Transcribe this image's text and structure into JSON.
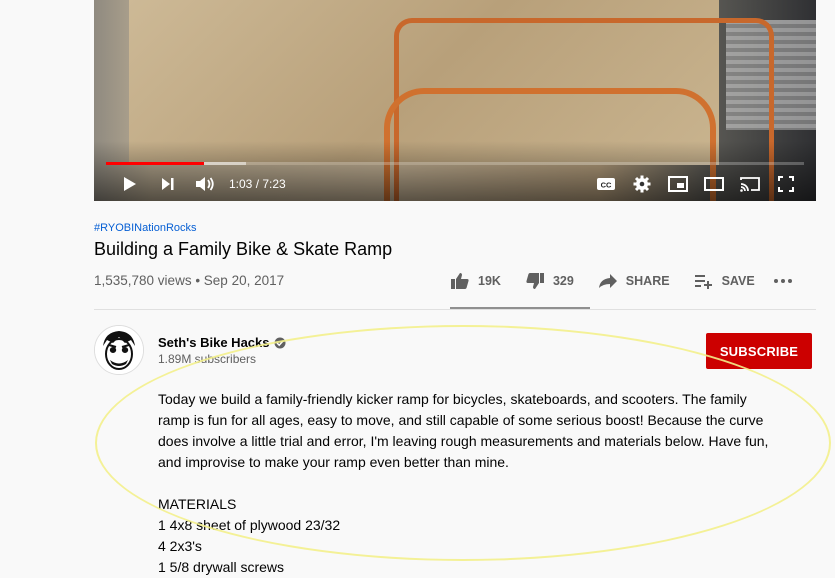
{
  "player": {
    "time": "1:03 / 7:23",
    "progress_played": 0.14,
    "progress_buffered": 0.2,
    "controls": [
      "play-icon",
      "next-icon",
      "volume-icon",
      "captions-icon",
      "settings-icon",
      "miniplayer-icon",
      "theater-icon",
      "cast-icon",
      "fullscreen-icon"
    ]
  },
  "video": {
    "hashtag": "#RYOBINationRocks",
    "title": "Building a Family Bike & Skate Ramp",
    "views_date": "1,535,780 views • Sep 20, 2017",
    "likes": "19K",
    "dislikes": "329",
    "share_label": "SHARE",
    "save_label": "SAVE"
  },
  "channel": {
    "name": "Seth's Bike Hacks",
    "subscribers": "1.89M subscribers",
    "subscribe_label": "SUBSCRIBE"
  },
  "description": {
    "text": "Today we build a family-friendly kicker ramp for bicycles, skateboards, and scooters. The family ramp is fun for all ages, easy to move, and still capable of some serious boost! Because the curve does involve a little trial and error, I'm leaving rough measurements and materials below. Have fun, and improvise to make your ramp even better than mine.",
    "materials_heading": "MATERIALS",
    "materials": [
      "1 4x8 sheet of plywood 23/32",
      "4 2x3's",
      "1 5/8 drywall screws"
    ]
  },
  "colors": {
    "subscribe_bg": "#cc0000",
    "hashtag": "#065fd4",
    "progress": "#ff0000",
    "annotation": "#f3f08b"
  }
}
